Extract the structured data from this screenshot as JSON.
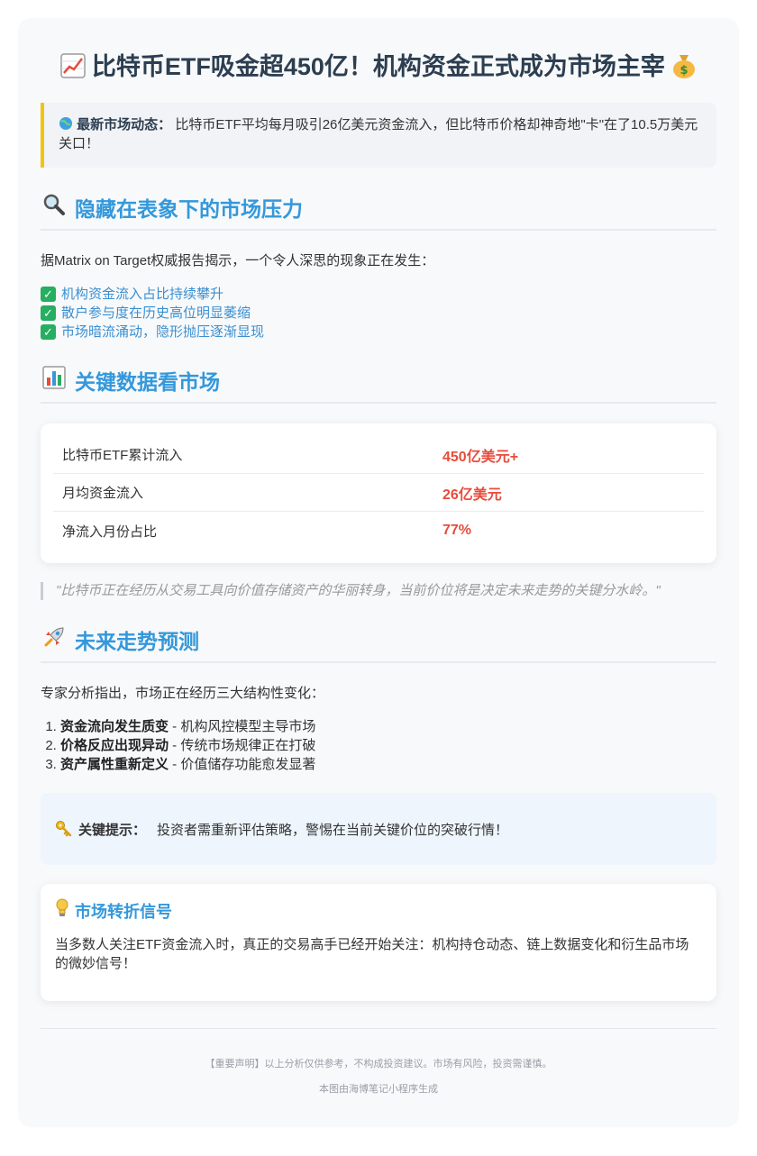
{
  "header": {
    "title": "比特币ETF吸金超450亿！机构资金正式成为市场主宰",
    "left_icon": "chart-increasing-icon",
    "right_icon": "money-bag-icon"
  },
  "news": {
    "icon": "globe-icon",
    "label": "最新市场动态：",
    "text": "比特币ETF平均每月吸引26亿美元资金流入，但比特币价格却神奇地\"卡\"在了10.5万美元关口！"
  },
  "section1": {
    "icon": "magnifier-icon",
    "heading": "隐藏在表象下的市场压力",
    "intro": "据Matrix on Target权威报告揭示，一个令人深思的现象正在发生：",
    "items": [
      "机构资金流入占比持续攀升",
      "散户参与度在历史高位明显萎缩",
      "市场暗流涌动，隐形抛压逐渐显现"
    ]
  },
  "section2": {
    "icon": "bar-chart-icon",
    "heading": "关键数据看市场",
    "rows": [
      {
        "label": "比特币ETF累计流入",
        "value": "450亿美元+"
      },
      {
        "label": "月均资金流入",
        "value": "26亿美元"
      },
      {
        "label": "净流入月份占比",
        "value": "77%"
      }
    ],
    "quote": "\"比特币正在经历从交易工具向价值存储资产的华丽转身，当前价位将是决定未来走势的关键分水岭。\""
  },
  "section3": {
    "icon": "rocket-icon",
    "heading": "未来走势预测",
    "intro": "专家分析指出，市场正在经历三大结构性变化：",
    "items": [
      {
        "bold": "资金流向发生质变",
        "rest": " - 机构风控模型主导市场"
      },
      {
        "bold": "价格反应出现异动",
        "rest": " - 传统市场规律正在打破"
      },
      {
        "bold": "资产属性重新定义",
        "rest": " - 价值储存功能愈发显著"
      }
    ]
  },
  "tip": {
    "icon": "key-icon",
    "label": "关键提示：",
    "text": "投资者需重新评估策略，警惕在当前关键价位的突破行情！"
  },
  "signal": {
    "icon": "light-bulb-icon",
    "title": "市场转折信号",
    "body": "当多数人关注ETF资金流入时，真正的交易高手已经开始关注：机构持仓动态、链上数据变化和衍生品市场的微妙信号！"
  },
  "footer": {
    "disclaimer": "【重要声明】以上分析仅供参考，不构成投资建议。市场有风险，投资需谨慎。",
    "credit": "本图由海博笔记小程序生成"
  },
  "colors": {
    "accent_blue": "#3498db",
    "value_red": "#e74c3c",
    "news_border": "#f1c40f",
    "check_green": "#27ae60"
  }
}
